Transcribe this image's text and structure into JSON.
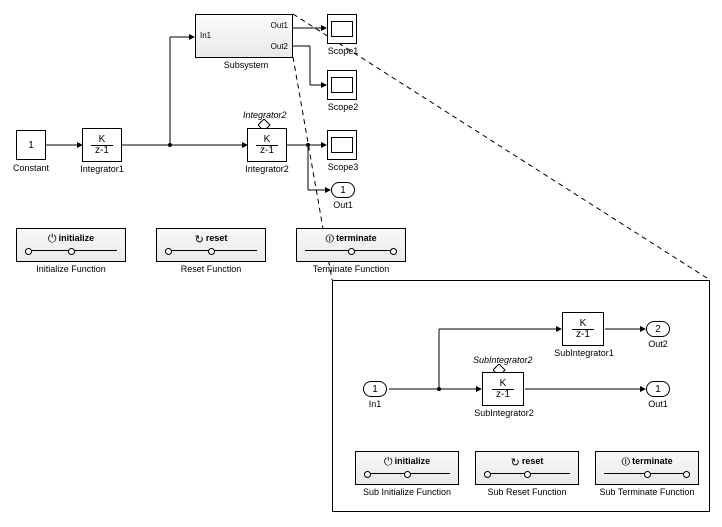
{
  "top": {
    "constant": {
      "value": "1",
      "label": "Constant"
    },
    "integrator1": {
      "num": "K",
      "den": "z-1",
      "label": "Integrator1"
    },
    "subsystem": {
      "label": "Subsystem",
      "in1": "In1",
      "out1": "Out1",
      "out2": "Out2"
    },
    "integrator2": {
      "num": "K",
      "den": "z-1",
      "label": "Integrator2",
      "state": "Integrator2"
    },
    "scope1": "Scope1",
    "scope2": "Scope2",
    "scope3": "Scope3",
    "out1": {
      "num": "1",
      "label": "Out1"
    },
    "init_fn": {
      "text": "initialize",
      "label": "Initialize Function"
    },
    "reset_fn": {
      "text": "reset",
      "label": "Reset Function"
    },
    "term_fn": {
      "text": "terminate",
      "label": "Terminate Function"
    }
  },
  "sub": {
    "in1": {
      "num": "1",
      "label": "In1"
    },
    "subint1": {
      "num": "K",
      "den": "z-1",
      "label": "SubIntegrator1"
    },
    "subint2": {
      "num": "K",
      "den": "z-1",
      "label": "SubIntegrator2",
      "state": "SubIntegrator2"
    },
    "out1": {
      "num": "1",
      "label": "Out1"
    },
    "out2": {
      "num": "2",
      "label": "Out2"
    },
    "init_fn": {
      "text": "initialize",
      "label": "Sub Initialize Function"
    },
    "reset_fn": {
      "text": "reset",
      "label": "Sub Reset Function"
    },
    "term_fn": {
      "text": "terminate",
      "label": "Sub Terminate Function"
    }
  }
}
